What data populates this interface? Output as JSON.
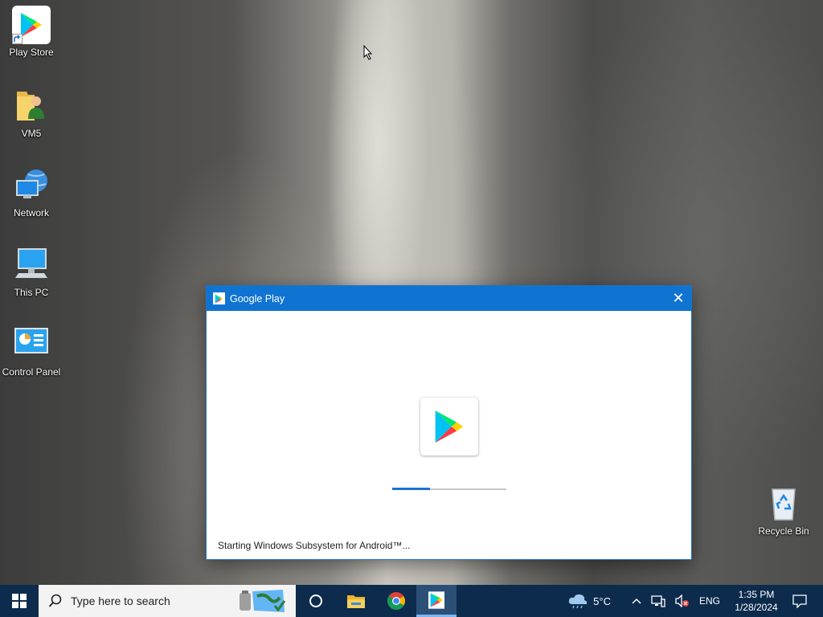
{
  "desktop": {
    "icons": [
      {
        "label": "Play Store"
      },
      {
        "label": "VM5"
      },
      {
        "label": "Network"
      },
      {
        "label": "This PC"
      },
      {
        "label": "Control Panel"
      },
      {
        "label": "Recycle Bin"
      }
    ]
  },
  "window": {
    "title": "Google Play",
    "close_glyph": "✕",
    "status": "Starting Windows Subsystem for Android™...",
    "progress": 0.33,
    "accent": "#0f73d2"
  },
  "taskbar": {
    "search_placeholder": "Type here to search",
    "weather": "5°C",
    "language": "ENG",
    "time": "1:35 PM",
    "date": "1/28/2024",
    "apps": [
      "cortana-icon",
      "file-explorer-icon",
      "chrome-icon",
      "google-play-icon"
    ],
    "background": "#0c2b4d"
  }
}
